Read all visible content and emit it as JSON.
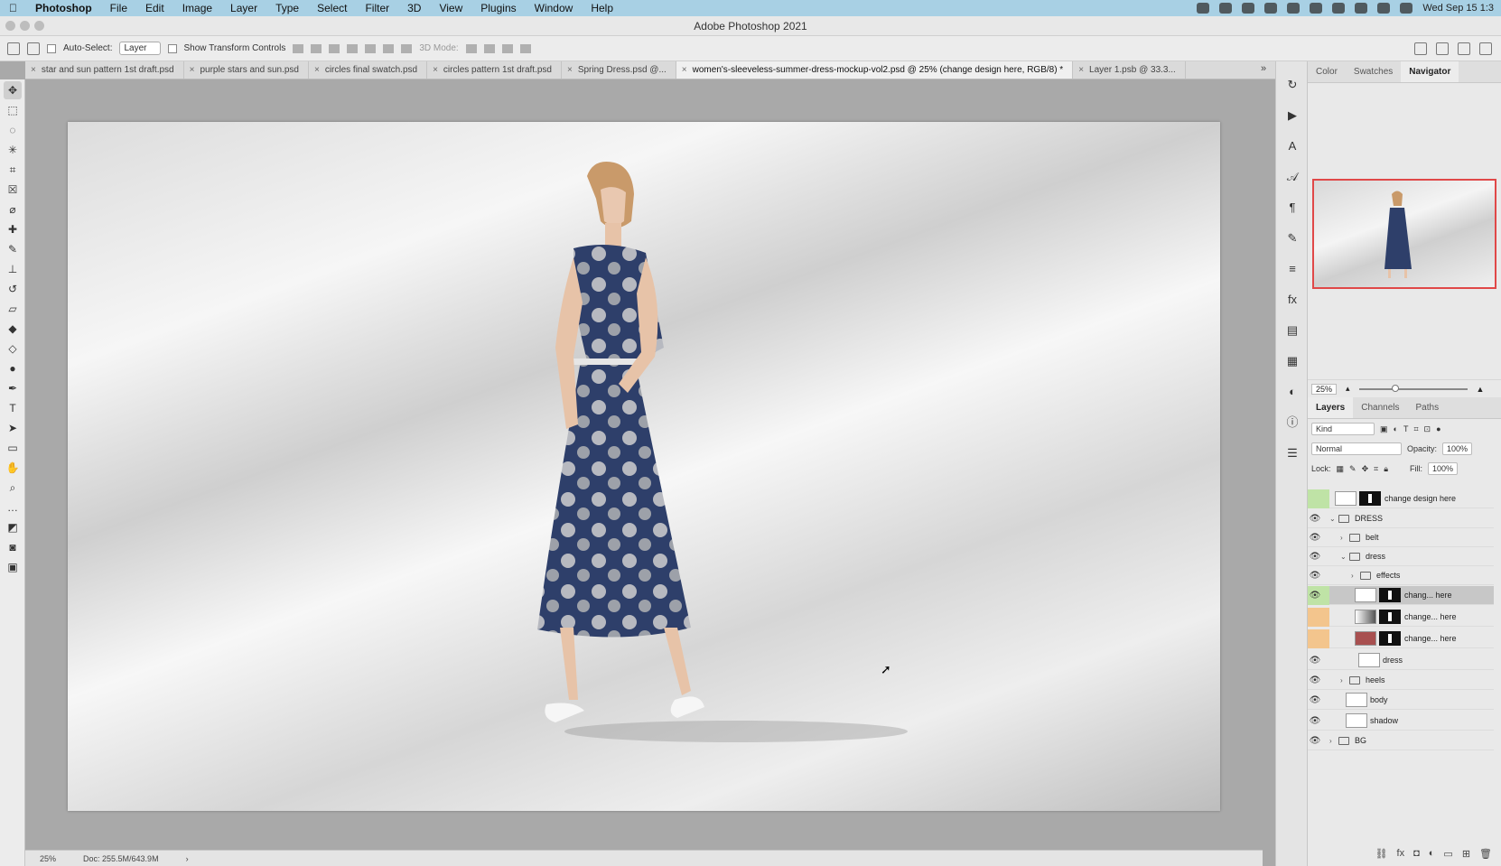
{
  "menubar": {
    "app": "Photoshop",
    "items": [
      "File",
      "Edit",
      "Image",
      "Layer",
      "Type",
      "Select",
      "Filter",
      "3D",
      "View",
      "Plugins",
      "Window",
      "Help"
    ],
    "clock": "Wed Sep 15 1:3"
  },
  "window": {
    "title": "Adobe Photoshop 2021"
  },
  "options": {
    "auto_select_label": "Auto-Select:",
    "auto_select_value": "Layer",
    "transform_label": "Show Transform Controls",
    "mode_3d_label": "3D Mode:"
  },
  "tabs": [
    {
      "label": "star and sun pattern 1st draft.psd"
    },
    {
      "label": "purple stars and sun.psd"
    },
    {
      "label": "circles final swatch.psd"
    },
    {
      "label": "circles pattern 1st draft.psd"
    },
    {
      "label": "Spring Dress.psd @..."
    },
    {
      "label": "women's-sleeveless-summer-dress-mockup-vol2.psd @ 25% (change design here, RGB/8) *"
    },
    {
      "label": "Layer 1.psb @ 33.3..."
    }
  ],
  "status": {
    "zoom": "25%",
    "doc": "Doc: 255.5M/643.9M"
  },
  "panel_top": {
    "tabs": [
      "Color",
      "Swatches",
      "Navigator"
    ],
    "zoom": "25%"
  },
  "layers_panel": {
    "tabs": [
      "Layers",
      "Channels",
      "Paths"
    ],
    "kind": "Kind",
    "blend": "Normal",
    "opacity_label": "Opacity:",
    "opacity": "100%",
    "lock_label": "Lock:",
    "fill_label": "Fill:",
    "fill": "100%",
    "layers": [
      {
        "name": "change design here"
      },
      {
        "name": "DRESS"
      },
      {
        "name": "belt"
      },
      {
        "name": "dress"
      },
      {
        "name": "effects"
      },
      {
        "name": "chang... here"
      },
      {
        "name": "change... here"
      },
      {
        "name": "change... here"
      },
      {
        "name": "dress"
      },
      {
        "name": "heels"
      },
      {
        "name": "body"
      },
      {
        "name": "shadow"
      },
      {
        "name": "BG"
      }
    ]
  },
  "colors": {
    "menubar": "#a8d0e4",
    "nav_frame": "#e04848",
    "eye_green": "#bfe3a6",
    "eye_orange": "#f3c58d",
    "dress": "#2e3f6a"
  }
}
